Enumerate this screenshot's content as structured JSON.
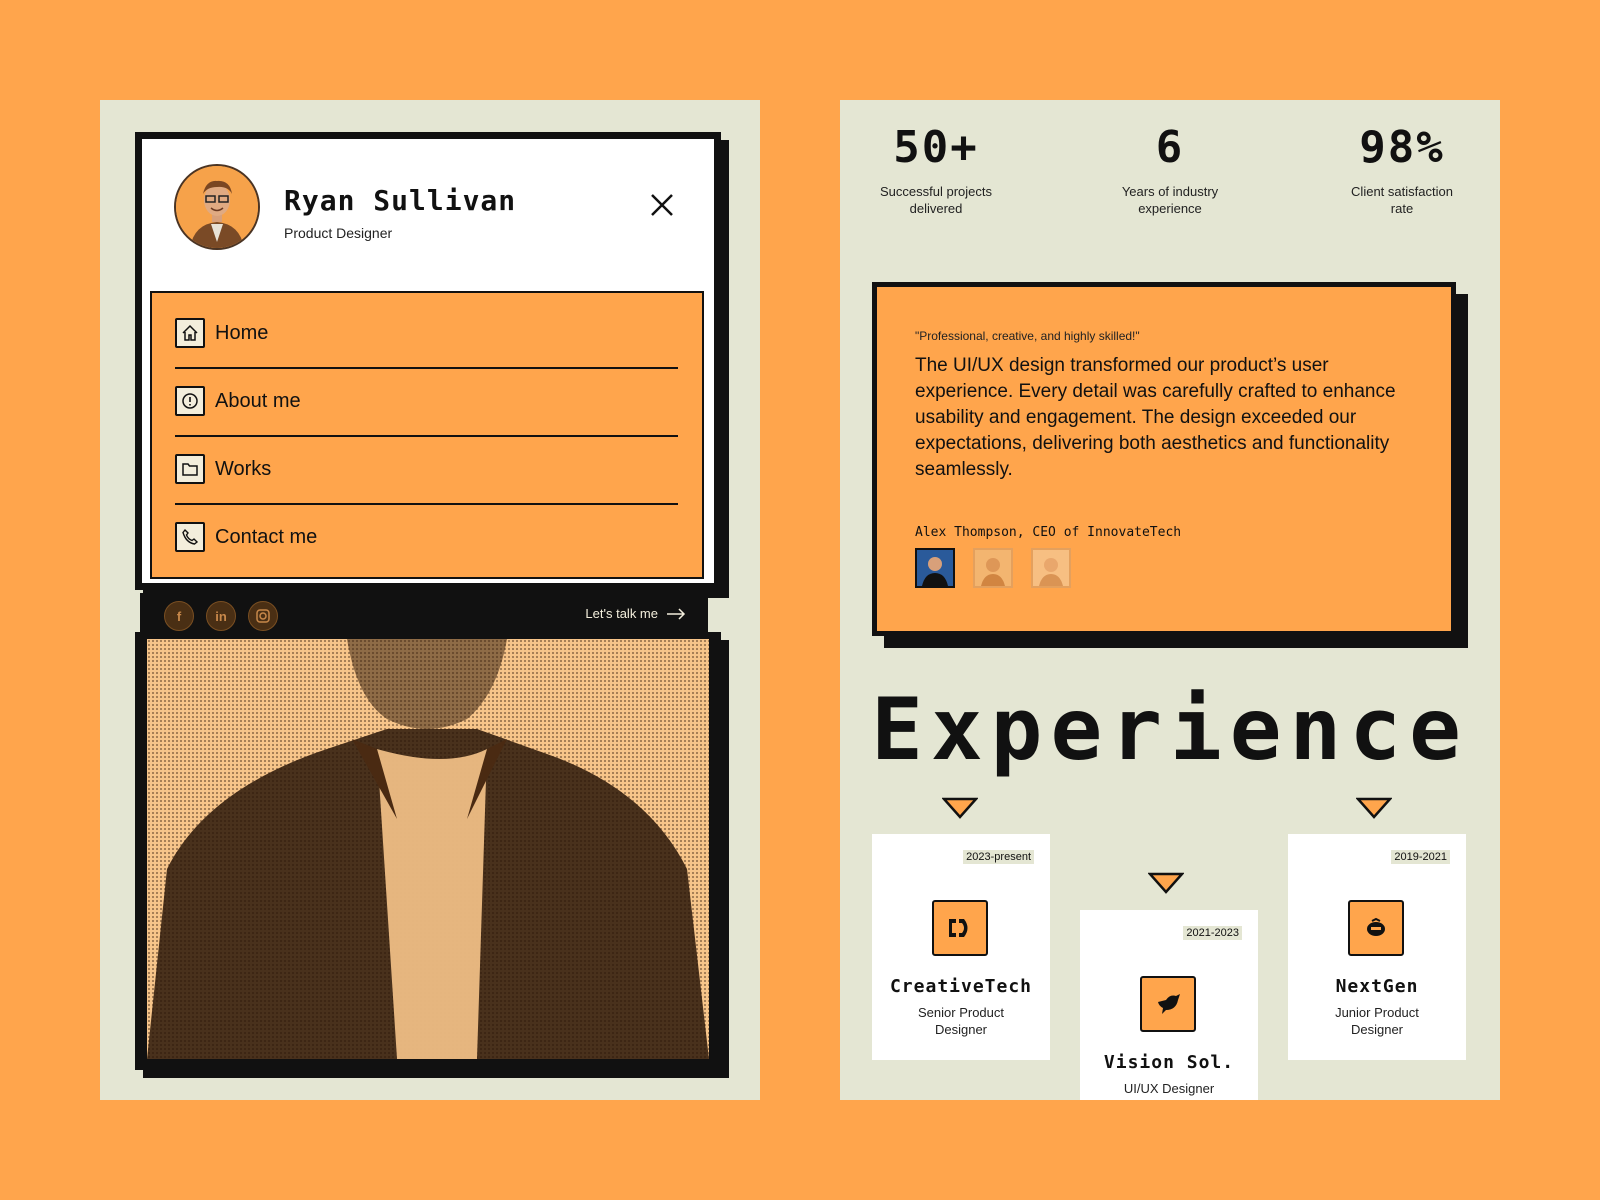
{
  "profile": {
    "name": "Ryan Sullivan",
    "role": "Product Designer"
  },
  "nav": {
    "items": [
      {
        "label": "Home",
        "icon": "home-icon"
      },
      {
        "label": "About me",
        "icon": "info-icon"
      },
      {
        "label": "Works",
        "icon": "folder-icon"
      },
      {
        "label": "Contact me",
        "icon": "phone-icon"
      }
    ]
  },
  "social": {
    "icons": [
      "facebook-icon",
      "linkedin-icon",
      "instagram-icon"
    ],
    "talk_label": "Let's talk me"
  },
  "stats": [
    {
      "value": "50+",
      "label": "Successful projects delivered"
    },
    {
      "value": "6",
      "label": "Years of industry experience"
    },
    {
      "value": "98%",
      "label": "Client satisfaction rate"
    }
  ],
  "testimonial": {
    "title": "\"Professional, creative, and highly skilled!\"",
    "body": "The UI/UX design transformed our product’s user experience. Every detail was carefully crafted to enhance usability and engagement. The design exceeded our expectations, delivering both aesthetics and functionality seamlessly.",
    "author": "Alex Thompson, CEO of InnovateTech"
  },
  "experience": {
    "title": "Experience",
    "items": [
      {
        "date": "2023-present",
        "company": "CreativeTech",
        "role": "Senior Product Designer"
      },
      {
        "date": "2021-2023",
        "company": "Vision Sol.",
        "role": "UI/UX Designer"
      },
      {
        "date": "2019-2021",
        "company": "NextGen",
        "role": "Junior Product Designer"
      }
    ]
  },
  "colors": {
    "background": "#FFA54C",
    "panel": "#E4E6D3",
    "accent": "#FFA54C",
    "ink": "#111111"
  }
}
